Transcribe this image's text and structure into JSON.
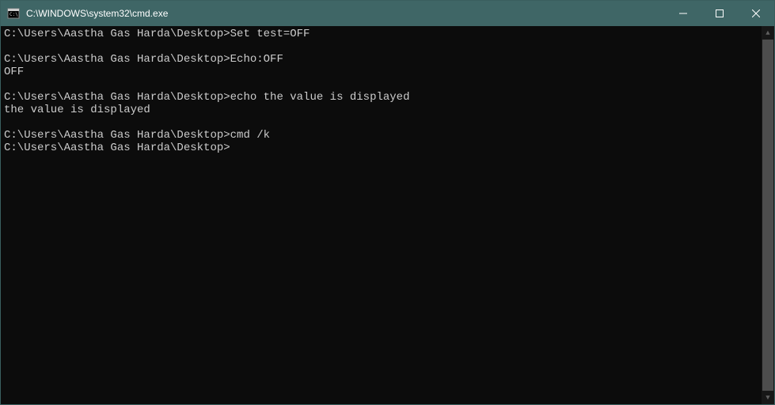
{
  "window": {
    "title": "C:\\WINDOWS\\system32\\cmd.exe"
  },
  "terminal": {
    "lines": [
      {
        "prompt": "C:\\Users\\Aastha Gas Harda\\Desktop>",
        "command": "Set test=OFF"
      },
      {
        "text": ""
      },
      {
        "prompt": "C:\\Users\\Aastha Gas Harda\\Desktop>",
        "command": "Echo:OFF"
      },
      {
        "text": "OFF"
      },
      {
        "text": ""
      },
      {
        "prompt": "C:\\Users\\Aastha Gas Harda\\Desktop>",
        "command": "echo the value is displayed"
      },
      {
        "text": "the value is displayed"
      },
      {
        "text": ""
      },
      {
        "prompt": "C:\\Users\\Aastha Gas Harda\\Desktop>",
        "command": "cmd /k"
      },
      {
        "prompt": "C:\\Users\\Aastha Gas Harda\\Desktop>",
        "command": ""
      }
    ]
  }
}
